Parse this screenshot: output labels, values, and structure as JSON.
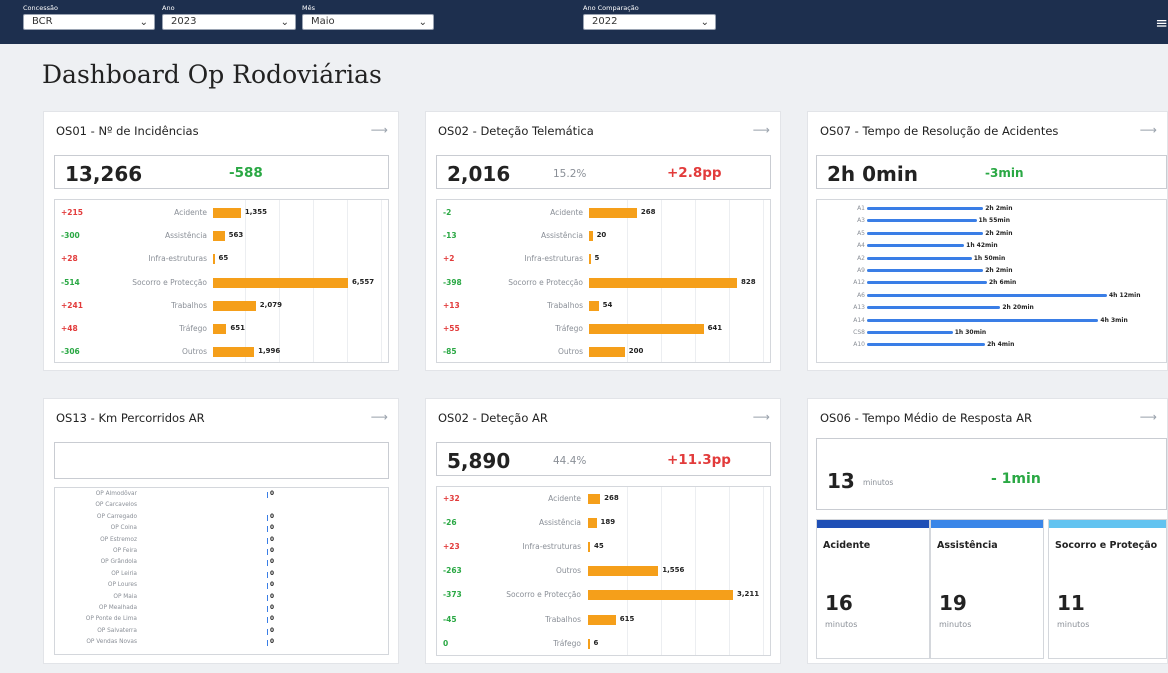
{
  "filters": [
    {
      "label": "Concessão",
      "value": "BCR"
    },
    {
      "label": "Ano",
      "value": "2023"
    },
    {
      "label": "Mês",
      "value": "Maio"
    },
    {
      "label": "Ano Comparação",
      "value": "2022"
    }
  ],
  "page_title": "Dashboard Op Rodoviárias",
  "colors": {
    "bar": "#f59f1a",
    "line": "#3a7ee6",
    "increase": "#e23b3b",
    "decrease": "#2aa844",
    "topbar": "#1d2f4e"
  },
  "icons": {
    "menu": "menu-icon",
    "arrow": "arrow-right-icon",
    "chevron": "chevron-down-icon"
  },
  "cards": {
    "incidencias": {
      "title": "OS01 - Nº de Incidências",
      "total": "13,266",
      "delta": "-588",
      "chart_data": {
        "type": "bar",
        "categories": [
          "Acidente",
          "Assistência",
          "Infra-estruturas",
          "Socorro e Protecção",
          "Trabalhos",
          "Tráfego",
          "Outros"
        ],
        "values": [
          1355,
          563,
          65,
          6557,
          2079,
          651,
          1996
        ],
        "labels": [
          "1,355",
          "563",
          "65",
          "6,557",
          "2,079",
          "651",
          "1,996"
        ],
        "deltas": [
          "+215",
          "-300",
          "+28",
          "-514",
          "+241",
          "+48",
          "-306"
        ]
      }
    },
    "telematica": {
      "title": "OS02 - Deteção Telemática",
      "total": "2,016",
      "pct": "15.2%",
      "delta": "+2.8pp",
      "chart_data": {
        "type": "bar",
        "categories": [
          "Acidente",
          "Assistência",
          "Infra-estruturas",
          "Socorro e Protecção",
          "Trabalhos",
          "Tráfego",
          "Outros"
        ],
        "values": [
          268,
          20,
          5,
          828,
          54,
          641,
          200
        ],
        "labels": [
          "268",
          "20",
          "5",
          "828",
          "54",
          "641",
          "200"
        ],
        "deltas": [
          "-2",
          "-13",
          "+2",
          "-398",
          "+13",
          "+55",
          "-85"
        ]
      }
    },
    "resolucao": {
      "title": "OS07 - Tempo de Resolução de Acidentes",
      "total": "2h 0min",
      "delta": "-3min",
      "chart_data": {
        "type": "bar",
        "categories": [
          "A1",
          "A3",
          "A5",
          "A4",
          "A2",
          "A9",
          "A12",
          "A6",
          "A13",
          "A14",
          "CS8",
          "A10"
        ],
        "values": [
          122,
          115,
          122,
          102,
          110,
          122,
          126,
          252,
          140,
          243,
          90,
          124
        ],
        "labels": [
          "2h 2min",
          "1h 55min",
          "2h 2min",
          "1h 42min",
          "1h 50min",
          "2h 2min",
          "2h 6min",
          "4h 12min",
          "2h 20min",
          "4h 3min",
          "1h 30min",
          "2h 4min"
        ]
      }
    },
    "km": {
      "title": "OS13 - Km Percorridos AR",
      "chart_data": {
        "type": "bar",
        "categories": [
          "OP Almodôvar",
          "OP Carcavelos",
          "OP Carregado",
          "OP Coina",
          "OP Estremoz",
          "OP Feira",
          "OP Grândola",
          "OP Leiria",
          "OP Loures",
          "OP Maia",
          "OP Mealhada",
          "OP Ponte de Lima",
          "OP Salvaterra",
          "OP Vendas Novas"
        ],
        "values": [
          0,
          null,
          0,
          0,
          0,
          0,
          0,
          0,
          0,
          0,
          0,
          0,
          0,
          0
        ],
        "labels": [
          "0",
          "",
          "0",
          "0",
          "0",
          "0",
          "0",
          "0",
          "0",
          "0",
          "0",
          "0",
          "0",
          "0"
        ]
      }
    },
    "detecao_ar": {
      "title": "OS02 - Deteção AR",
      "total": "5,890",
      "pct": "44.4%",
      "delta": "+11.3pp",
      "chart_data": {
        "type": "bar",
        "categories": [
          "Acidente",
          "Assistência",
          "Infra-estruturas",
          "Outros",
          "Socorro e Protecção",
          "Trabalhos",
          "Tráfego"
        ],
        "values": [
          268,
          189,
          45,
          1556,
          3211,
          615,
          6
        ],
        "labels": [
          "268",
          "189",
          "45",
          "1,556",
          "3,211",
          "615",
          "6"
        ],
        "deltas": [
          "+32",
          "-26",
          "+23",
          "-263",
          "-373",
          "-45",
          "0"
        ]
      }
    },
    "resposta": {
      "title": "OS06 - Tempo Médio de Resposta AR",
      "total": "13",
      "unit": "minutos",
      "delta": "- 1min",
      "tiles": [
        {
          "name": "Acidente",
          "value": "16",
          "unit": "minutos",
          "color": "#1f4fb6"
        },
        {
          "name": "Assistência",
          "value": "19",
          "unit": "minutos",
          "color": "#3a86e8"
        },
        {
          "name": "Socorro e Proteção",
          "value": "11",
          "unit": "minutos",
          "color": "#62c3f0"
        }
      ]
    }
  }
}
